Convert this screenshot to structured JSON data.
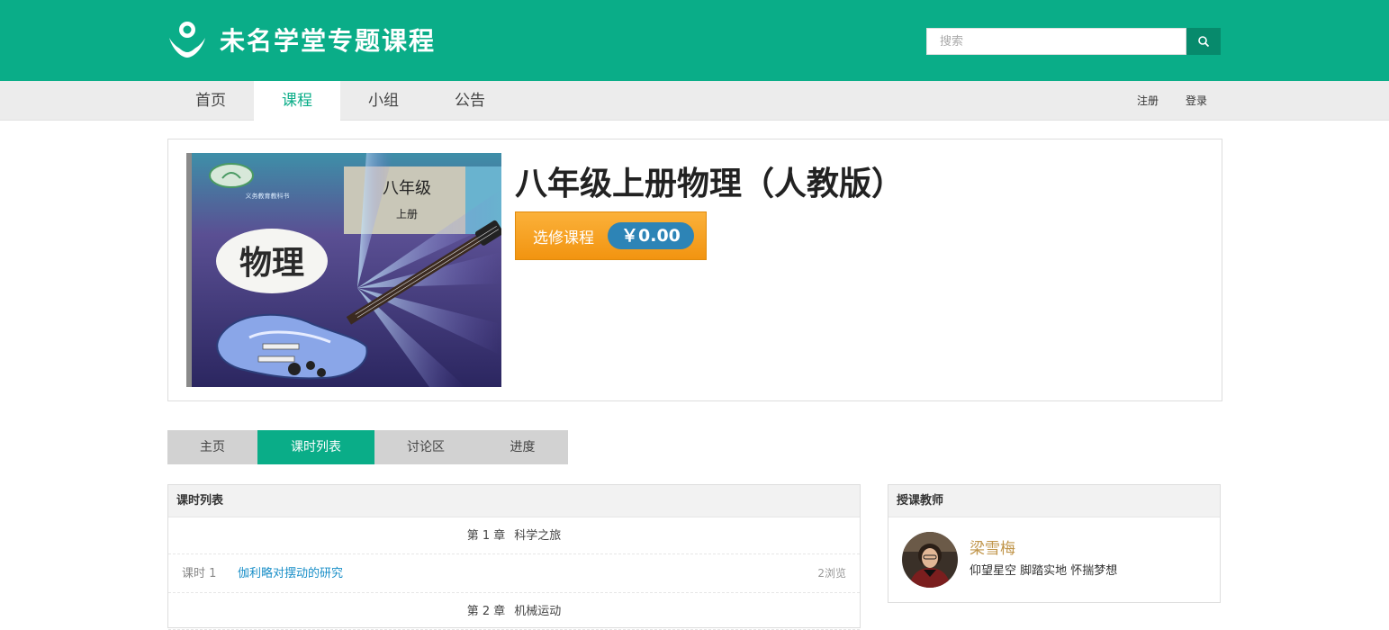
{
  "brand": {
    "name": "未名学堂专题课程",
    "logo_icon": "person-logo-icon",
    "color": "#0aad88"
  },
  "search": {
    "placeholder": "搜索",
    "button_icon": "search-icon"
  },
  "nav": {
    "items": [
      {
        "label": "首页"
      },
      {
        "label": "课程",
        "active": true
      },
      {
        "label": "小组"
      },
      {
        "label": "公告"
      }
    ],
    "register": "注册",
    "login": "登录"
  },
  "course": {
    "title": "八年级上册物理（人教版）",
    "enroll_label": "选修课程",
    "price": "￥0.00",
    "cover": {
      "grade": "八年级",
      "volume": "上册",
      "subject": "物理",
      "series": "义务教育教科书"
    }
  },
  "tabs": [
    {
      "label": "主页"
    },
    {
      "label": "课时列表",
      "active": true
    },
    {
      "label": "讨论区"
    },
    {
      "label": "进度"
    }
  ],
  "lessons_panel": {
    "title": "课时列表",
    "rows": [
      {
        "type": "chapter",
        "num": "第 1 章",
        "title": "科学之旅"
      },
      {
        "type": "lesson",
        "num": "课时 1",
        "title": "伽利略对摆动的研究",
        "views": "2浏览"
      },
      {
        "type": "chapter",
        "num": "第 2 章",
        "title": "机械运动"
      }
    ]
  },
  "teacher_panel": {
    "title": "授课教师",
    "name": "梁雪梅",
    "motto": "仰望星空 脚踏实地 怀揣梦想"
  },
  "colors": {
    "accent": "#0aad88",
    "orange": "#f39c12",
    "price_pill": "#2d84b6",
    "link": "#1a8fc8"
  }
}
